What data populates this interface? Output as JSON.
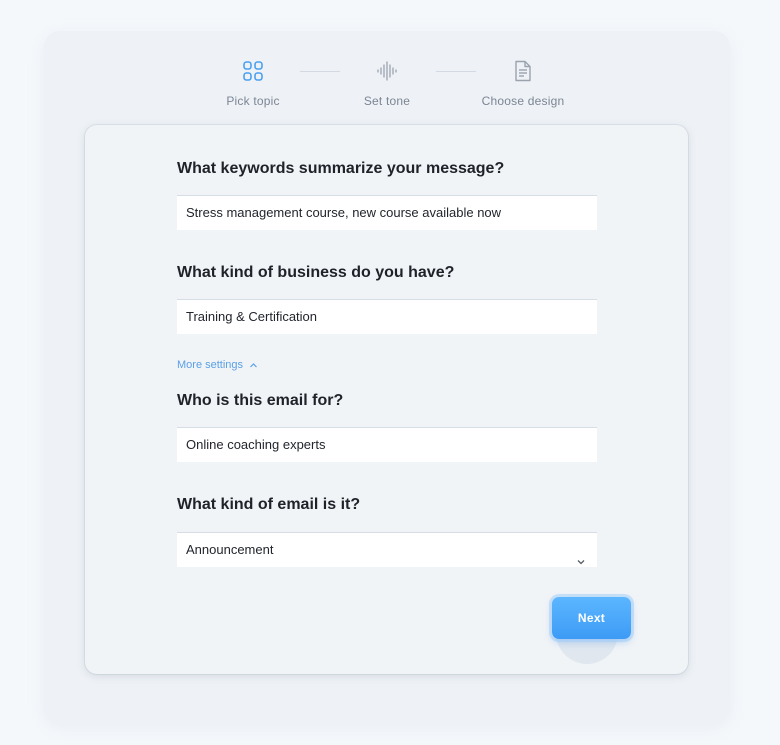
{
  "colors": {
    "accent": "#4aa6f8",
    "link": "#5aa0e6",
    "step_icon_active": "#4a9ff0",
    "step_icon_inactive": "#9aa3ae"
  },
  "stepper": {
    "steps": [
      {
        "label": "Pick topic",
        "icon": "grid-icon",
        "active": true
      },
      {
        "label": "Set tone",
        "icon": "soundwave-icon",
        "active": false
      },
      {
        "label": "Choose design",
        "icon": "document-icon",
        "active": false
      }
    ]
  },
  "form": {
    "keywords": {
      "question": "What keywords summarize your message?",
      "value": "Stress management course, new course available now"
    },
    "business": {
      "question": "What kind of business do you have?",
      "value": "Training & Certification"
    },
    "more_settings": {
      "label": "More settings",
      "icon": "chevron-up-icon"
    },
    "audience": {
      "question": "Who is this email for?",
      "value": "Online coaching experts"
    },
    "email_type": {
      "question": "What kind of email is it?",
      "selected": "Announcement",
      "icon": "chevron-down-icon"
    }
  },
  "actions": {
    "next_label": "Next"
  }
}
